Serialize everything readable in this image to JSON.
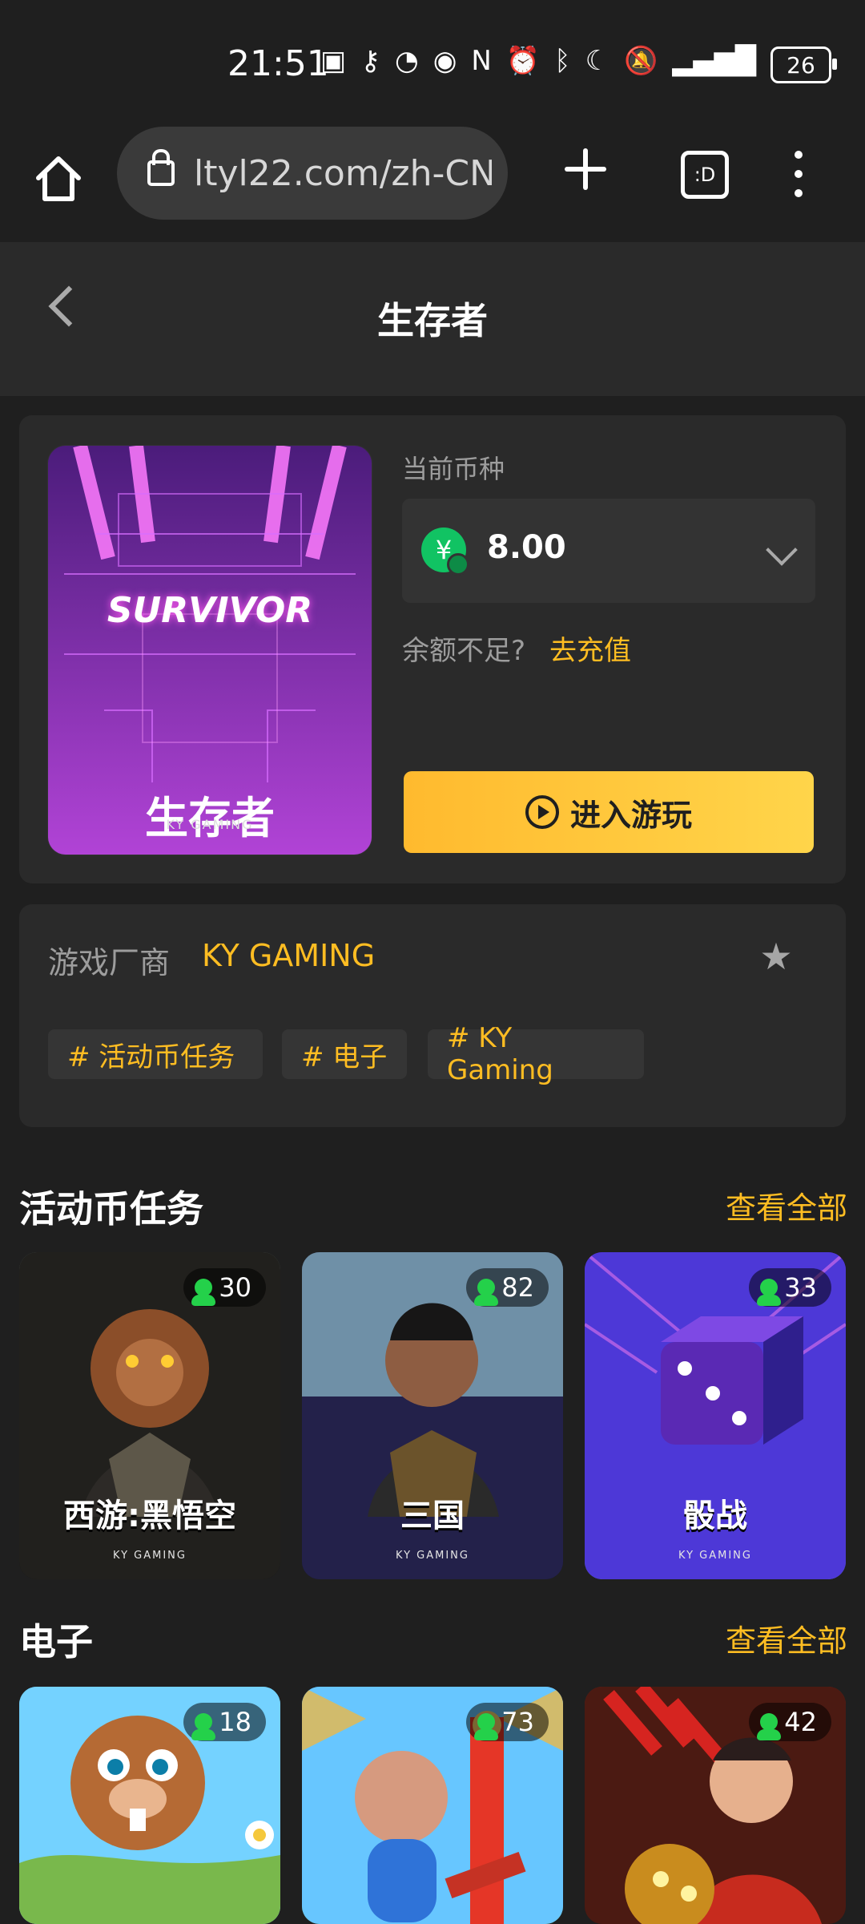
{
  "status": {
    "time": "21:51",
    "battery": "26"
  },
  "browser": {
    "url": "ltyl22.com/zh-CN",
    "tabs_label": ":D"
  },
  "header": {
    "title": "生存者"
  },
  "game": {
    "cover_title": "SURVIVOR",
    "cover_subtitle": "生存者",
    "brand": "KY GAMING",
    "currency_label": "当前币种",
    "amount": "8.00",
    "currency_symbol": "¥",
    "balance_text": "余额不足?",
    "recharge_text": "去充值",
    "enter_text": "进入游玩"
  },
  "vendor": {
    "label": "游戏厂商",
    "name": "KY GAMING",
    "tags": [
      "# 活动币任务",
      "# 电子",
      "# KY Gaming"
    ]
  },
  "sections": [
    {
      "title": "活动币任务",
      "view_all": "查看全部",
      "games": [
        {
          "title": "西游:黑悟空",
          "players": "30",
          "brand": "KY GAMING"
        },
        {
          "title": "三国",
          "players": "82",
          "brand": "KY GAMING"
        },
        {
          "title": "骰战",
          "players": "33",
          "brand": "KY GAMING"
        }
      ]
    },
    {
      "title": "电子",
      "view_all": "查看全部",
      "games": [
        {
          "players": "18"
        },
        {
          "players": "73"
        },
        {
          "players": "42"
        }
      ]
    }
  ],
  "colors": {
    "background": "#1f1f1f",
    "panel": "#2a2a2a",
    "accent": "#ffbd22",
    "online": "#24d14a"
  }
}
